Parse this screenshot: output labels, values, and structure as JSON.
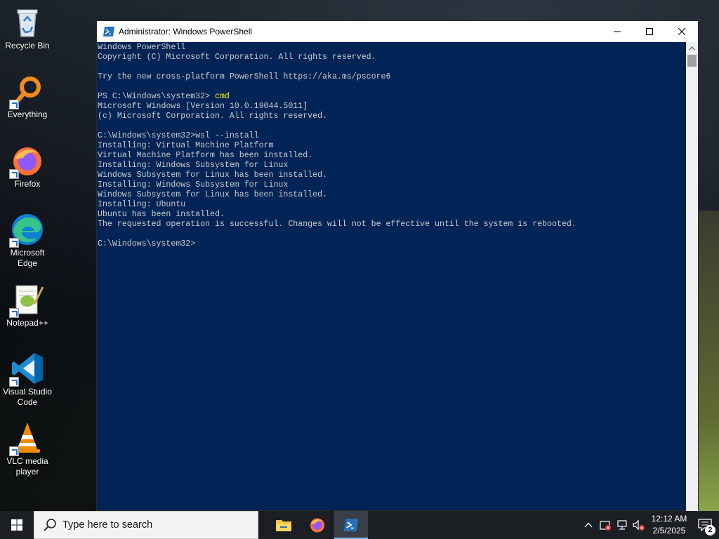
{
  "desktop": {
    "icons": [
      {
        "label": "Recycle Bin",
        "icon": "recycle-bin-icon"
      },
      {
        "label": "Everything",
        "icon": "everything-search-icon"
      },
      {
        "label": "Firefox",
        "icon": "firefox-icon"
      },
      {
        "label": "Microsoft Edge",
        "icon": "edge-icon"
      },
      {
        "label": "Notepad++",
        "icon": "notepadpp-icon"
      },
      {
        "label": "Visual Studio Code",
        "icon": "vscode-icon"
      },
      {
        "label": "VLC media player",
        "icon": "vlc-icon"
      }
    ]
  },
  "window": {
    "title": "Administrator: Windows PowerShell",
    "controls": {
      "minimize": "─",
      "maximize": "☐",
      "close": "✕"
    }
  },
  "console": {
    "lines": [
      {
        "text": "Windows PowerShell"
      },
      {
        "text": "Copyright (C) Microsoft Corporation. All rights reserved."
      },
      {
        "text": ""
      },
      {
        "text": "Try the new cross-platform PowerShell https://aka.ms/pscore6"
      },
      {
        "text": ""
      },
      {
        "prompt": "PS C:\\Windows\\system32> ",
        "cmd": "cmd"
      },
      {
        "text": "Microsoft Windows [Version 10.0.19044.5011]"
      },
      {
        "text": "(c) Microsoft Corporation. All rights reserved."
      },
      {
        "text": ""
      },
      {
        "text": "C:\\Windows\\system32>wsl --install"
      },
      {
        "text": "Installing: Virtual Machine Platform"
      },
      {
        "text": "Virtual Machine Platform has been installed."
      },
      {
        "text": "Installing: Windows Subsystem for Linux"
      },
      {
        "text": "Windows Subsystem for Linux has been installed."
      },
      {
        "text": "Installing: Windows Subsystem for Linux"
      },
      {
        "text": "Windows Subsystem for Linux has been installed."
      },
      {
        "text": "Installing: Ubuntu"
      },
      {
        "text": "Ubuntu has been installed."
      },
      {
        "text": "The requested operation is successful. Changes will not be effective until the system is rebooted."
      },
      {
        "text": ""
      },
      {
        "text": "C:\\Windows\\system32>"
      }
    ],
    "colors": {
      "background": "#012456",
      "text": "#cccccc",
      "command": "#f2f200"
    }
  },
  "taskbar": {
    "search_placeholder": "Type here to search",
    "apps": [
      {
        "name": "file-explorer",
        "icon": "folder-icon",
        "active": false
      },
      {
        "name": "firefox",
        "icon": "firefox-icon",
        "active": false
      },
      {
        "name": "powershell",
        "icon": "powershell-icon",
        "active": true
      }
    ],
    "tray": {
      "time": "12:12 AM",
      "date": "2/5/2025",
      "notification_count": "2"
    }
  }
}
